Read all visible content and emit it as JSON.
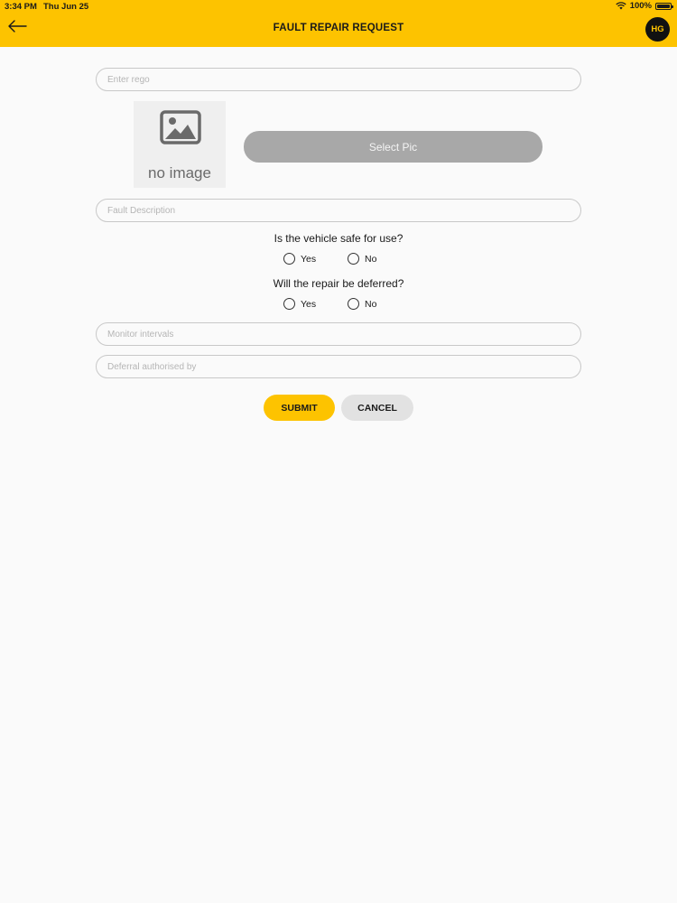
{
  "status_bar": {
    "time": "3:34 PM",
    "date": "Thu Jun 25",
    "battery": "100%",
    "wifi_icon": "wifi-icon",
    "battery_icon": "battery-icon"
  },
  "header": {
    "title": "FAULT REPAIR REQUEST",
    "back_icon": "arrow-left-icon",
    "avatar_initials": "HG",
    "background_color": "#fdc300"
  },
  "form": {
    "rego_placeholder": "Enter rego",
    "image_placeholder_text": "no image",
    "image_placeholder_icon": "image-icon",
    "select_pic_label": "Select Pic",
    "fault_description_placeholder": "Fault Description",
    "safe_question": "Is the vehicle safe for use?",
    "safe_options": [
      "Yes",
      "No"
    ],
    "deferred_question": "Will the repair be deferred?",
    "deferred_options": [
      "Yes",
      "No"
    ],
    "monitor_placeholder": "Monitor intervals",
    "deferral_placeholder": "Deferral authorised by",
    "submit_label": "SUBMIT",
    "cancel_label": "CANCEL"
  },
  "colors": {
    "accent": "#fdc300",
    "select_button": "#a8a8a8",
    "cancel_button": "#e2e2e2"
  }
}
